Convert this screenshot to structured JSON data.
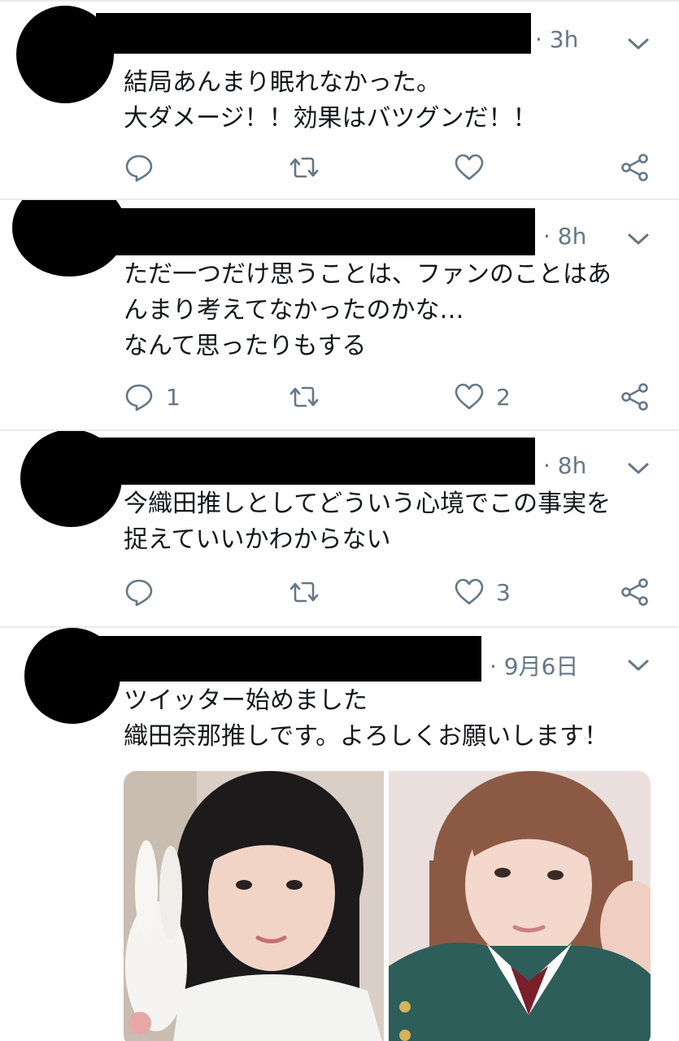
{
  "colors": {
    "border": "#e6ecf0",
    "text": "#14171a",
    "muted": "#657786",
    "redaction": "#000000"
  },
  "icons": {
    "reply": "reply-icon",
    "retweet": "retweet-icon",
    "like": "like-icon",
    "share": "share-icon",
    "caret": "chevron-down-icon"
  },
  "tweets": [
    {
      "time": "· 3h",
      "text_lines": [
        "結局あんまり眠れなかった。",
        "大ダメージ！！効果はバツグンだ！！"
      ],
      "reply_count": "",
      "like_count": ""
    },
    {
      "time": "· 8h",
      "text_lines": [
        "ただ一つだけ思うことは、ファンのことはあ",
        "んまり考えてなかったのかな…",
        "なんて思ったりもする"
      ],
      "reply_count": "1",
      "like_count": "2"
    },
    {
      "time": "· 8h",
      "text_lines": [
        "今織田推しとしてどういう心境でこの事実を",
        "捉えていいかわからない"
      ],
      "reply_count": "",
      "like_count": "3"
    },
    {
      "time": "· 9月6日",
      "text_lines": [
        "ツイッター始めました",
        "織田奈那推しです。よろしくお願いします！"
      ],
      "reply_count": "",
      "like_count": "",
      "media": [
        "photo-1",
        "photo-2"
      ]
    }
  ]
}
